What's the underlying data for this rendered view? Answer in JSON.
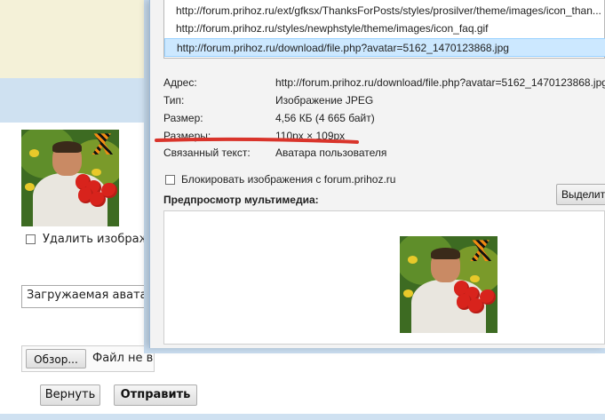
{
  "background": {
    "remove_avatar_label": "Удалить изображ",
    "avatar_select_value": "Загружаемая аватар",
    "browse_button": "Обзор...",
    "file_status": "Файл не в",
    "reset_button": "Вернуть",
    "submit_button": "Отправить"
  },
  "dialog": {
    "urls": [
      "http://forum.prihoz.ru/ext/gfksx/ThanksForPosts/styles/prosilver/theme/images/icon_than...",
      "http://forum.prihoz.ru/styles/newphstyle/theme/images/icon_faq.gif",
      "http://forum.prihoz.ru/download/file.php?avatar=5162_1470123868.jpg"
    ],
    "properties": [
      {
        "label": "Адрес:",
        "value": "http://forum.prihoz.ru/download/file.php?avatar=5162_1470123868.jpg"
      },
      {
        "label": "Тип:",
        "value": "Изображение JPEG"
      },
      {
        "label": "Размер:",
        "value": "4,56 КБ (4 665 байт)"
      },
      {
        "label": "Размеры:",
        "value": "110px × 109px"
      },
      {
        "label": "Связанный текст:",
        "value": "Аватара пользователя"
      }
    ],
    "block_images_label": "Блокировать изображения с forum.prihoz.ru",
    "select_button": "Выделить",
    "preview_label": "Предпросмотр мультимедиа:"
  },
  "colors": {
    "highlight_underline": "#d9342b",
    "selection": "#cce8ff"
  }
}
